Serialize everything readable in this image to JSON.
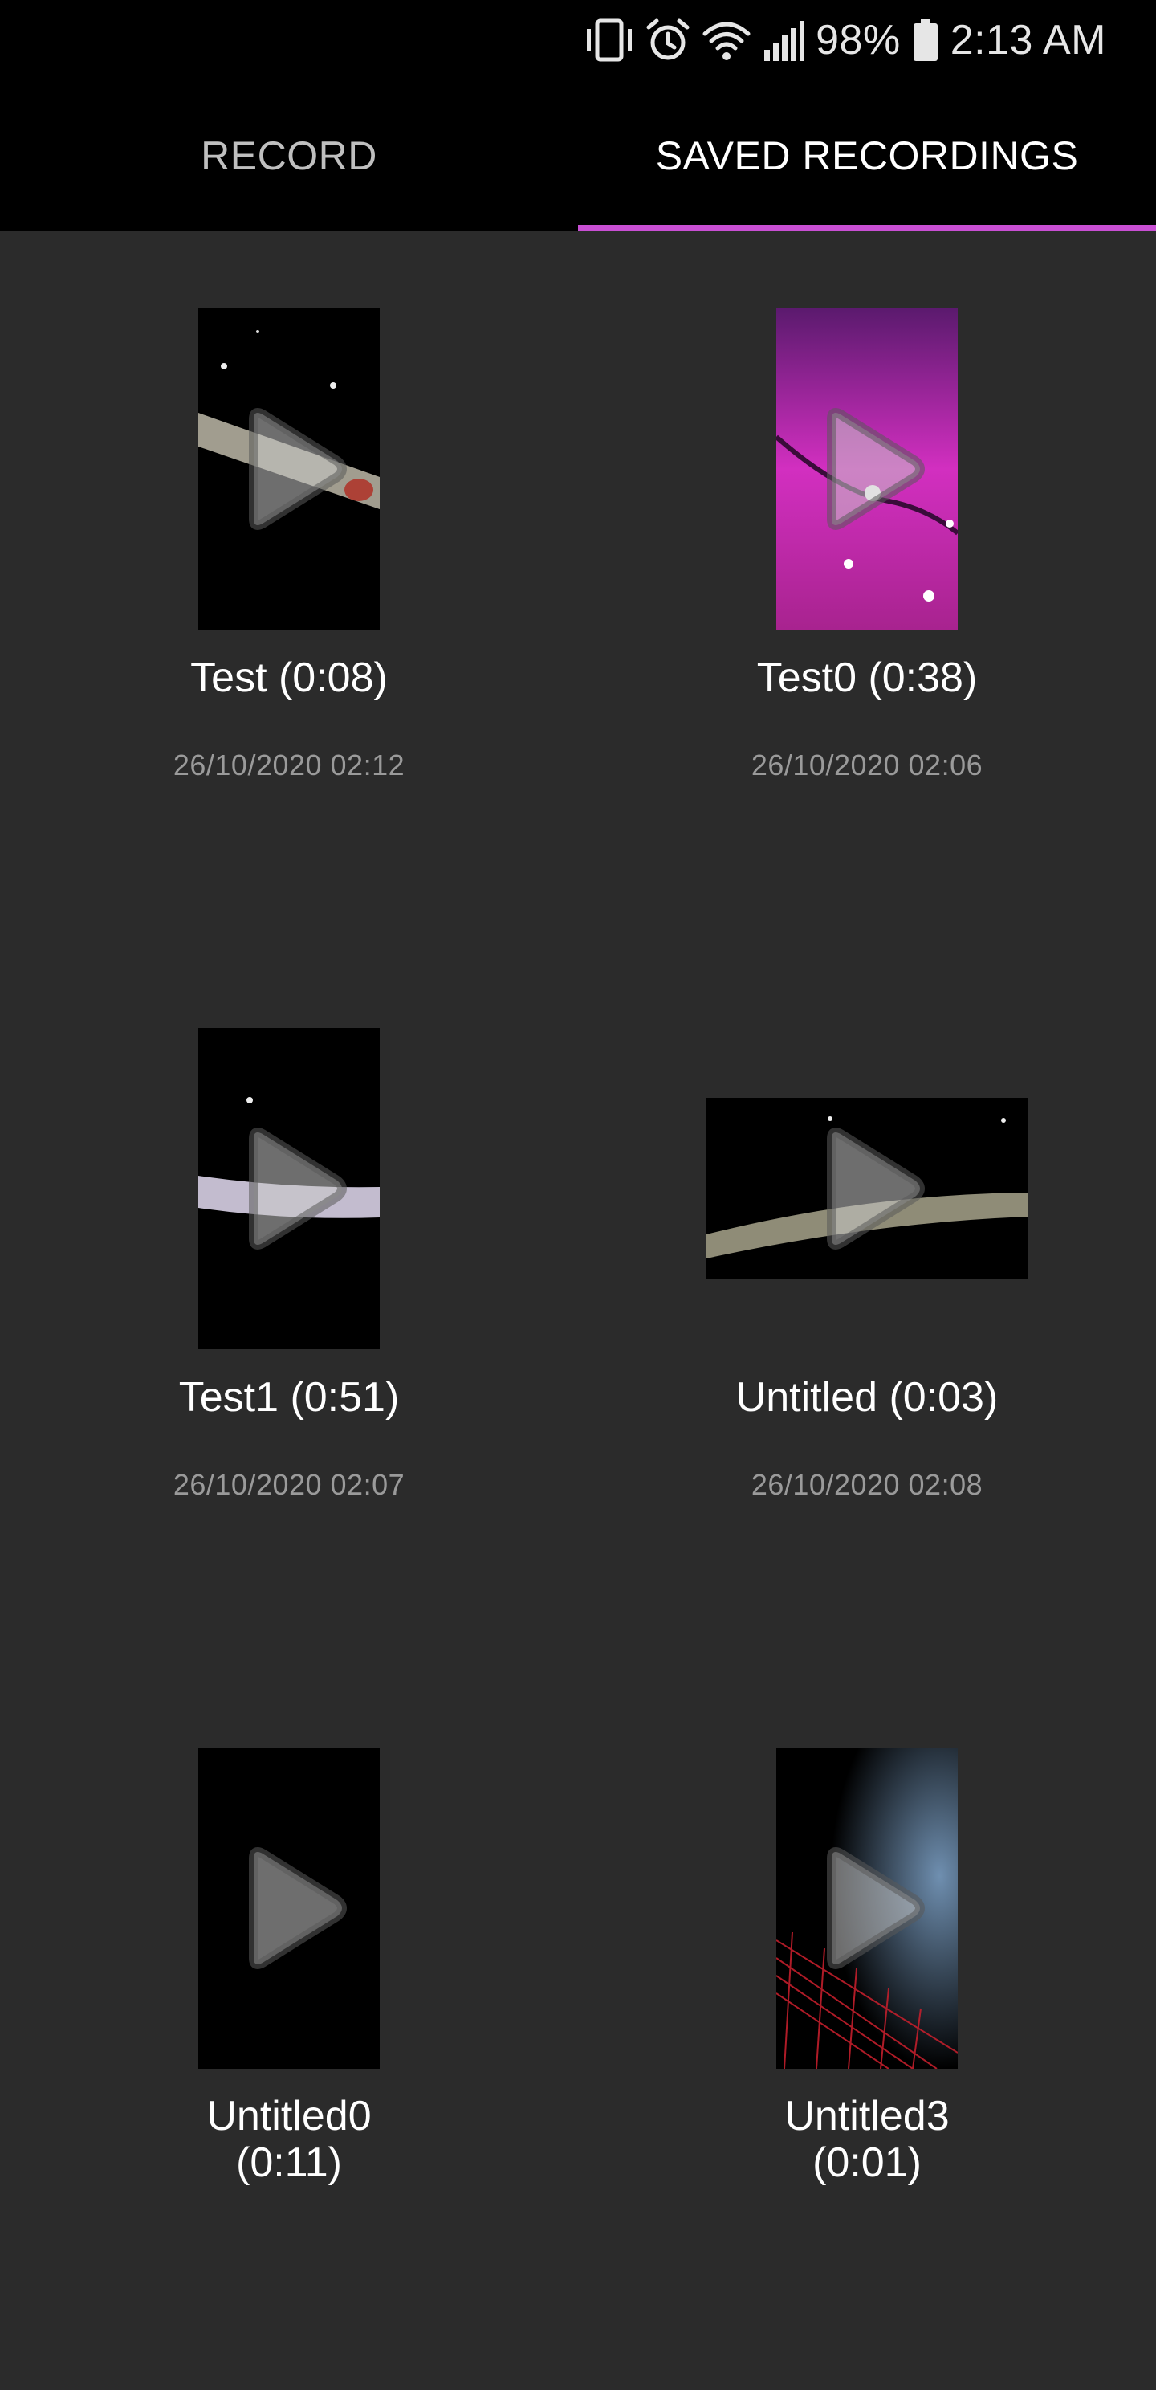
{
  "status_bar": {
    "battery_percent": "98%",
    "time": "2:13 AM",
    "icons": [
      "vibrate-icon",
      "alarm-icon",
      "wifi-icon",
      "signal-icon",
      "battery-icon"
    ]
  },
  "tabs": [
    {
      "label": "RECORD",
      "active": false
    },
    {
      "label": "SAVED RECORDINGS",
      "active": true
    }
  ],
  "accent_color": "#c84fd3",
  "recordings": [
    {
      "title": "Test (0:08)",
      "date": "26/10/2020 02:12",
      "orientation": "portrait"
    },
    {
      "title": "Test0 (0:38)",
      "date": "26/10/2020 02:06",
      "orientation": "portrait"
    },
    {
      "title": "Test1 (0:51)",
      "date": "26/10/2020 02:07",
      "orientation": "portrait"
    },
    {
      "title": "Untitled (0:03)",
      "date": "26/10/2020 02:08",
      "orientation": "landscape"
    },
    {
      "title_line1": "Untitled0",
      "title_line2": "(0:11)",
      "orientation": "portrait"
    },
    {
      "title_line1": "Untitled3",
      "title_line2": "(0:01)",
      "orientation": "portrait"
    }
  ]
}
